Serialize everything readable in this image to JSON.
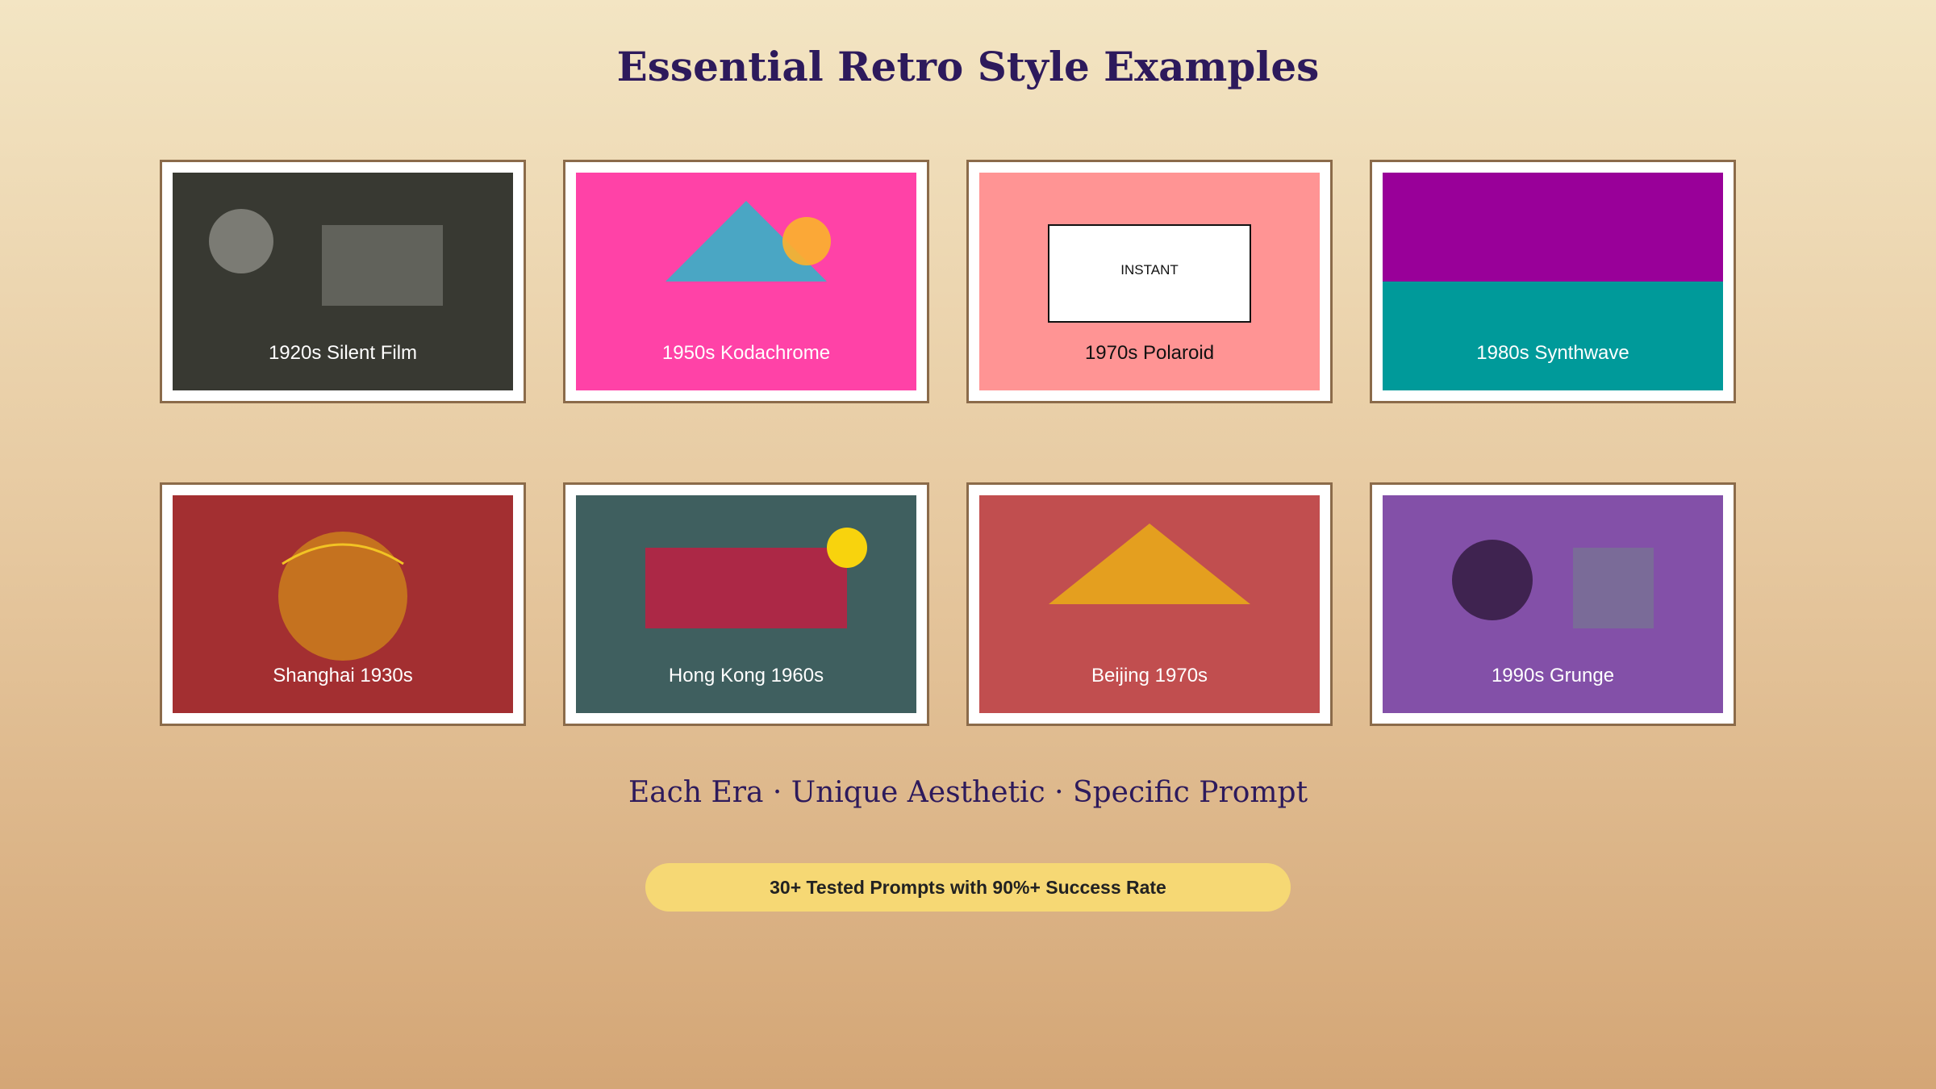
{
  "page": {
    "title": "Essential Retro Style Examples",
    "tagline": "Each Era · Unique Aesthetic · Specific Prompt",
    "badge": "30+ Tested Prompts with 90%+ Success Rate"
  },
  "cards": [
    {
      "caption": "1920s Silent Film",
      "background": "#383932",
      "icon": "circle-and-rectangle"
    },
    {
      "caption": "1950s Kodachrome",
      "background": "#ff42a7",
      "icon": "mountain-and-sun"
    },
    {
      "caption": "1970s Polaroid",
      "background": "#ff9494",
      "icon": "instant-photo-frame",
      "frame_text": "INSTANT"
    },
    {
      "caption": "1980s Synthwave",
      "background": "#009a9a",
      "icon": "split-horizon",
      "accent": "#990099"
    },
    {
      "caption": "Shanghai 1930s",
      "background": "#a32f31",
      "icon": "circle-with-arc"
    },
    {
      "caption": "Hong Kong 1960s",
      "background": "#3f5f5f",
      "icon": "rectangle-and-sun"
    },
    {
      "caption": "Beijing 1970s",
      "background": "#c14e4f",
      "icon": "triangle"
    },
    {
      "caption": "1990s Grunge",
      "background": "#8350a8",
      "icon": "circle-and-square"
    }
  ],
  "colors": {
    "title": "#2d1a5c",
    "card_border": "#8b6b4a",
    "badge_background": "#f6d874"
  }
}
